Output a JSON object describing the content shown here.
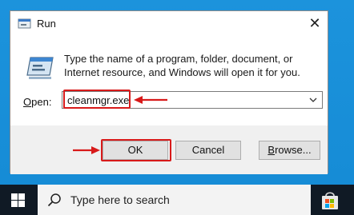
{
  "window": {
    "title": "Run",
    "description": "Type the name of a program, folder, document, or Internet resource, and Windows will open it for you.",
    "close_glyph": "✕"
  },
  "open_field": {
    "label_accesskey": "O",
    "label_rest": "pen:",
    "value": "cleanmgr.exe"
  },
  "buttons": {
    "ok": "OK",
    "cancel": "Cancel",
    "browse_accesskey": "B",
    "browse_rest": "rowse..."
  },
  "taskbar": {
    "search_placeholder": "Type here to search"
  },
  "colors": {
    "annotation": "#d81a1a",
    "desktop": "#1a8fd8",
    "taskbar": "#101a25"
  },
  "icons": [
    "run-title-icon",
    "run-program-icon",
    "close-icon",
    "dropdown-arrow-icon",
    "windows-logo-icon",
    "search-icon",
    "microsoft-store-icon"
  ]
}
